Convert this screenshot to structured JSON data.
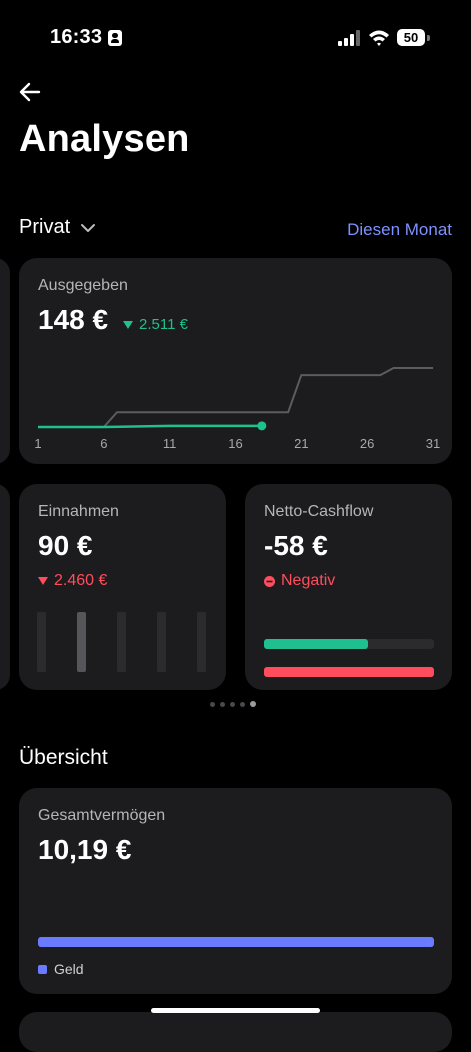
{
  "status_bar": {
    "time": "16:33",
    "battery": "50"
  },
  "header": {
    "title": "Analysen"
  },
  "filter": {
    "account": "Privat",
    "period": "Diesen Monat"
  },
  "spent_card": {
    "label": "Ausgegeben",
    "value": "148 €",
    "comparison": "2.511 €",
    "chart_data": {
      "type": "line",
      "x_ticks": [
        "1",
        "6",
        "11",
        "16",
        "21",
        "26",
        "31"
      ],
      "series": [
        {
          "points": [
            [
              1,
              0
            ],
            [
              6,
              0
            ],
            [
              11,
              2
            ],
            [
              16,
              2
            ],
            [
              18,
              2
            ]
          ]
        },
        {
          "points": [
            [
              1,
              0
            ],
            [
              6,
              0
            ],
            [
              7,
              25
            ],
            [
              20,
              25
            ],
            [
              21,
              88
            ],
            [
              27,
              88
            ],
            [
              28,
              100
            ],
            [
              31,
              100
            ]
          ]
        }
      ]
    }
  },
  "income_card": {
    "label": "Einnahmen",
    "value": "90 €",
    "comparison": "2.460 €",
    "chart_data": {
      "type": "bar",
      "values": [
        60,
        60,
        60,
        60,
        60
      ],
      "highlight_index": 1
    }
  },
  "cashflow_card": {
    "label": "Netto-Cashflow",
    "value": "-58 €",
    "status": "Negativ",
    "income_fraction": 0.61,
    "expense_fraction": 1.0
  },
  "overview": {
    "title": "Übersicht",
    "net_worth_card": {
      "label": "Gesamtvermögen",
      "value": "10,19 €",
      "legend_label": "Geld",
      "money_fraction": 1.0
    }
  },
  "colors": {
    "accent": "#7d92ff",
    "positive": "#1fbf8f",
    "negative": "#ff4d5e",
    "card": "#1c1c1e",
    "money": "#6a7bff"
  }
}
